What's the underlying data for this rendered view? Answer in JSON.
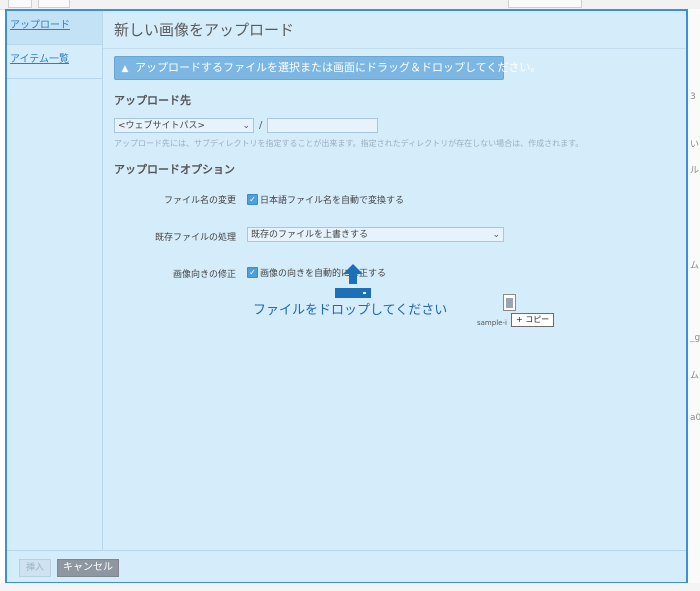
{
  "background": {
    "fragments": [
      "3",
      "い",
      "ル",
      "ム",
      "_g",
      "ム",
      "a0"
    ]
  },
  "sidebar": {
    "items": [
      {
        "label": "アップロード"
      },
      {
        "label": "アイテム一覧"
      }
    ]
  },
  "dialog": {
    "title": "新しい画像をアップロード",
    "upload_button_label": "アップロードするファイルを選択または画面にドラッグ＆ドロップしてください。",
    "destination": {
      "heading": "アップロード先",
      "path_select_value": "<ウェブサイトパス>",
      "separator": "/",
      "subdir_value": "",
      "hint": "アップロード先には、サブディレクトリを指定することが出来ます。指定されたディレクトリが存在しない場合は、作成されます。"
    },
    "options": {
      "heading": "アップロードオプション",
      "rename": {
        "label": "ファイル名の変更",
        "checkbox_label": "日本語ファイル名を自動で変換する",
        "checked": true
      },
      "existing": {
        "label": "既存ファイルの処理",
        "select_value": "既存のファイルを上書きする"
      },
      "orientation": {
        "label": "画像向きの修正",
        "checkbox_label": "画像の向きを自動的に修正する",
        "checked": true
      }
    },
    "drop_overlay": {
      "text": "ファイルをドロップしてください",
      "file_name": "sample-i",
      "copy_badge": "+ コピー"
    },
    "footer": {
      "insert_label": "挿入",
      "cancel_label": "キャンセル"
    }
  },
  "colors": {
    "accent": "#3d8fd6",
    "dialog_bg": "#d5ecfb",
    "drop_blue": "#2268b0"
  }
}
